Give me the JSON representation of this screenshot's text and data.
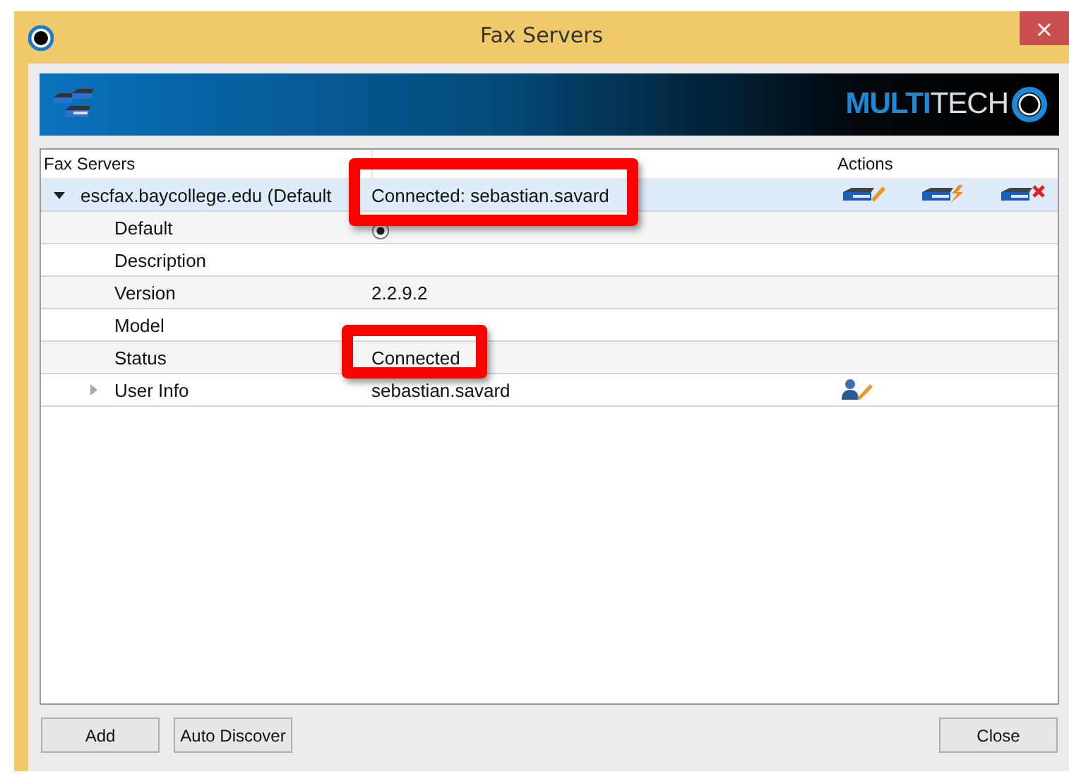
{
  "window": {
    "title": "Fax Servers",
    "close": "×"
  },
  "banner": {
    "logo": "**MULTI**TECH"
  },
  "tree": {
    "columns": [
      "Fax Servers",
      "",
      "Actions"
    ],
    "servers": [
      {
        "name": "escfax.baycollege.edu (Default",
        "status": "Connected: sebastian.savard",
        "expanded": true,
        "selected": true,
        "children": [
          {
            "label": "Default",
            "kind": "radio",
            "checked": true
          },
          {
            "label": "Description",
            "kind": "text"
          },
          {
            "label": "Version",
            "kind": "text",
            "value": "2.2.9.2"
          },
          {
            "label": "Model",
            "kind": "text"
          },
          {
            "label": "Status",
            "kind": "text",
            "value": "Connected"
          },
          {
            "label": "User Info",
            "kind": "user",
            "value": "sebastian.savard",
            "expanded": false
          }
        ]
      }
    ]
  },
  "buttons": [
    {
      "label": "Add"
    },
    {
      "label": "Auto Discover"
    },
    {
      "label": "Close"
    }
  ]
}
